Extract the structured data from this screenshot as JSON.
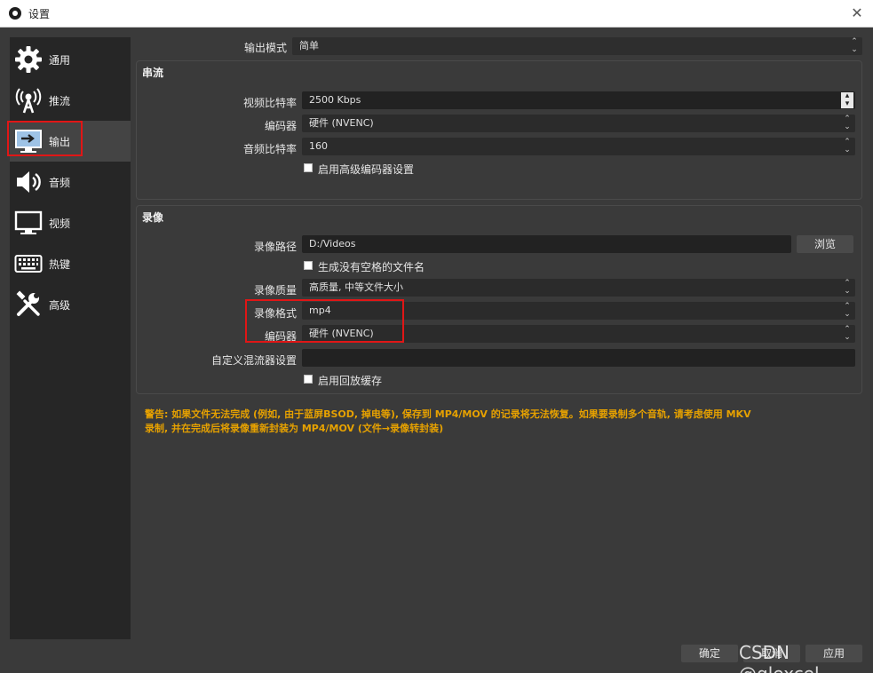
{
  "window": {
    "title": "设置"
  },
  "sidebar": {
    "items": [
      {
        "label": "通用",
        "icon": "gear-icon"
      },
      {
        "label": "推流",
        "icon": "antenna-icon"
      },
      {
        "label": "输出",
        "icon": "monitor-arrow-icon",
        "active": true
      },
      {
        "label": "音频",
        "icon": "speaker-icon"
      },
      {
        "label": "视频",
        "icon": "monitor-icon"
      },
      {
        "label": "热键",
        "icon": "keyboard-icon"
      },
      {
        "label": "高级",
        "icon": "tools-icon"
      }
    ]
  },
  "output": {
    "mode_label": "输出模式",
    "mode_value": "简单",
    "streaming": {
      "title": "串流",
      "video_bitrate_label": "视频比特率",
      "video_bitrate_value": "2500 Kbps",
      "encoder_label": "编码器",
      "encoder_value": "硬件 (NVENC)",
      "audio_bitrate_label": "音频比特率",
      "audio_bitrate_value": "160",
      "advanced_encoder_label": "启用高级编码器设置"
    },
    "recording": {
      "title": "录像",
      "path_label": "录像路径",
      "path_value": "D:/Videos",
      "browse_label": "浏览",
      "no_space_label": "生成没有空格的文件名",
      "quality_label": "录像质量",
      "quality_value": "高质量, 中等文件大小",
      "format_label": "录像格式",
      "format_value": "mp4",
      "encoder_label": "编码器",
      "encoder_value": "硬件 (NVENC)",
      "muxer_label": "自定义混流器设置",
      "muxer_value": "",
      "replay_label": "启用回放缓存"
    },
    "warning_line1": "警告: 如果文件无法完成 (例如, 由于蓝屏BSOD, 掉电等), 保存到 MP4/MOV 的记录将无法恢复。如果要录制多个音轨, 请考虑使用 MKV",
    "warning_line2": "录制, 并在完成后将录像重新封装为 MP4/MOV (文件→录像转封装)"
  },
  "footer": {
    "ok_label": "确定",
    "cancel_label": "取消",
    "apply_label": "应用",
    "watermark": "CSDN @qlexcel"
  }
}
